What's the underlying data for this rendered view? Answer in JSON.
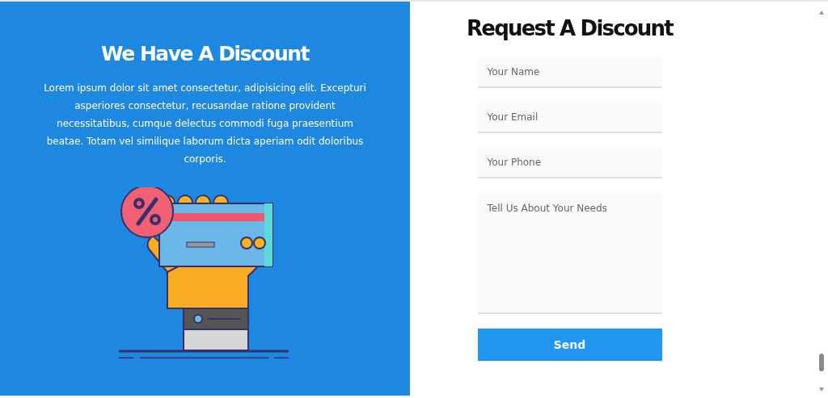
{
  "promo": {
    "title": "We Have A Discount",
    "text": "Lorem ipsum dolor sit amet consectetur, adipisicing elit. Excepturi asperiores consectetur, recusandae ratione provident necessitatibus, cumque delectus commodi fuga praesentium beatae. Totam vel similique laborum dicta aperiam odit doloribus corporis."
  },
  "form": {
    "title": "Request A Discount",
    "fields": [
      {
        "kind": "input",
        "placeholder": "Your Name"
      },
      {
        "kind": "input",
        "placeholder": "Your Email"
      },
      {
        "kind": "input",
        "placeholder": "Your Phone"
      },
      {
        "kind": "textarea",
        "placeholder": "Tell Us About Your Needs"
      }
    ],
    "button": "Send"
  }
}
